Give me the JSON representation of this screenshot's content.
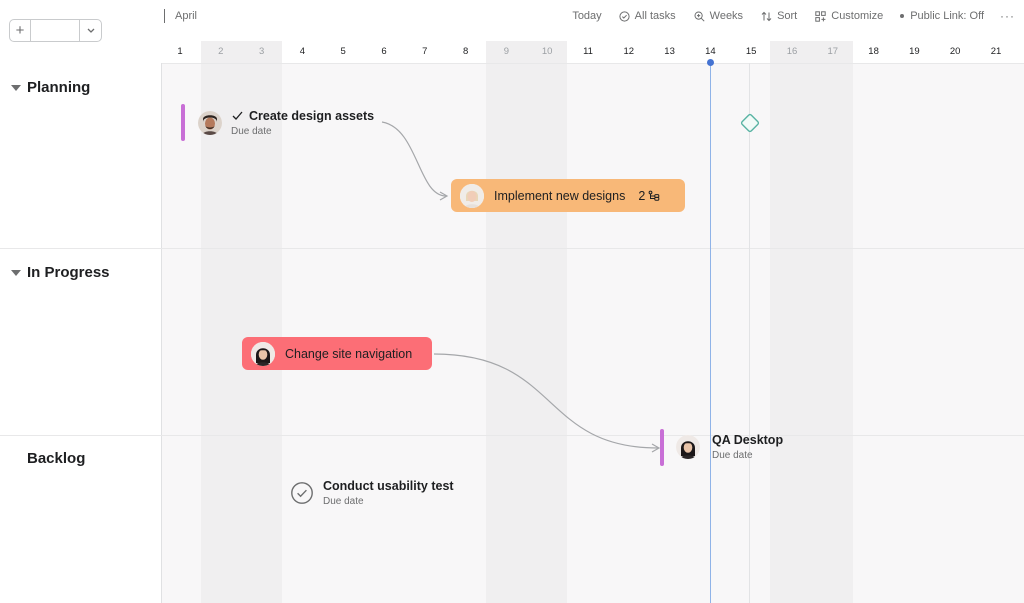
{
  "header": {
    "month": "April",
    "toolbar": {
      "today": "Today",
      "all_tasks": "All tasks",
      "weeks": "Weeks",
      "sort": "Sort",
      "customize": "Customize",
      "public_link": "Public Link: Off",
      "more": "···"
    }
  },
  "days": [
    "1",
    "2",
    "3",
    "4",
    "5",
    "6",
    "7",
    "8",
    "9",
    "10",
    "11",
    "12",
    "13",
    "14",
    "15",
    "16",
    "17",
    "18",
    "19",
    "20",
    "21"
  ],
  "sections": [
    {
      "title": "Planning"
    },
    {
      "title": "In Progress"
    },
    {
      "title": "Backlog"
    }
  ],
  "tasks": {
    "create_design_assets": {
      "title": "Create design assets",
      "subtitle": "Due date"
    },
    "implement_new_designs": {
      "title": "Implement new designs",
      "subtask_count": "2",
      "color": "#f8b878"
    },
    "change_site_navigation": {
      "title": "Change site navigation",
      "color": "#fc6e76"
    },
    "qa_desktop": {
      "title": "QA Desktop",
      "subtitle": "Due date"
    },
    "conduct_usability_test": {
      "title": "Conduct usability test",
      "subtitle": "Due date"
    }
  },
  "colors": {
    "accent_today": "#4573d2",
    "due_bar": "#c86fd6",
    "milestone": "#58b3a3"
  },
  "icons": {
    "add": "plus-icon",
    "dropdown": "chevron-down-icon",
    "all_tasks": "check-circle-icon",
    "weeks": "zoom-icon",
    "sort": "sort-icon",
    "customize": "grid-icon",
    "public_link": "dot-icon",
    "subtasks": "subtask-icon",
    "milestone": "diamond-icon"
  }
}
